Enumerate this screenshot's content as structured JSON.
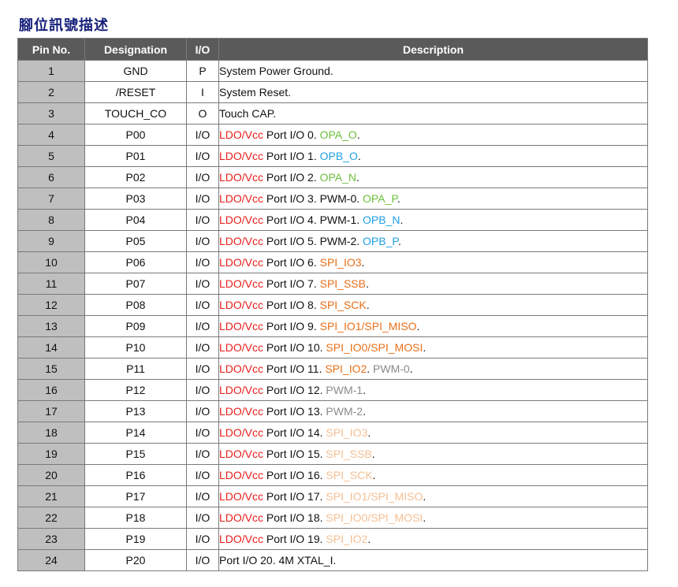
{
  "title": "腳位訊號描述",
  "colors": {
    "header_bg": "#5a5a5a",
    "pin_col_bg": "#bfbfbf",
    "title": "#16207a",
    "red": "#e8201c",
    "green": "#6cbf3a",
    "blue": "#1ea0e6",
    "orange": "#ea6f18",
    "gray": "#8a8a8a",
    "peach": "#f5bf93"
  },
  "headers": [
    "Pin No.",
    "Designation",
    "I/O",
    "Description"
  ],
  "rows": [
    {
      "pin": "1",
      "designation": "GND",
      "io": "P",
      "desc": [
        {
          "t": "System Power Ground.",
          "c": ""
        }
      ]
    },
    {
      "pin": "2",
      "designation": "/RESET",
      "io": "I",
      "desc": [
        {
          "t": "System Reset.",
          "c": ""
        }
      ]
    },
    {
      "pin": "3",
      "designation": "TOUCH_CO",
      "io": "O",
      "desc": [
        {
          "t": "Touch CAP.",
          "c": ""
        }
      ]
    },
    {
      "pin": "4",
      "designation": "P00",
      "io": "I/O",
      "desc": [
        {
          "t": "LDO/Vcc",
          "c": "red"
        },
        {
          "t": " Port I/O 0. ",
          "c": ""
        },
        {
          "t": "OPA_O",
          "c": "green"
        },
        {
          "t": ".",
          "c": ""
        }
      ]
    },
    {
      "pin": "5",
      "designation": "P01",
      "io": "I/O",
      "desc": [
        {
          "t": "LDO/Vcc",
          "c": "red"
        },
        {
          "t": " Port I/O 1. ",
          "c": ""
        },
        {
          "t": "OPB_O",
          "c": "blue"
        },
        {
          "t": ".",
          "c": ""
        }
      ]
    },
    {
      "pin": "6",
      "designation": "P02",
      "io": "I/O",
      "desc": [
        {
          "t": "LDO/Vcc",
          "c": "red"
        },
        {
          "t": " Port I/O 2. ",
          "c": ""
        },
        {
          "t": "OPA_N",
          "c": "green"
        },
        {
          "t": ".",
          "c": ""
        }
      ]
    },
    {
      "pin": "7",
      "designation": "P03",
      "io": "I/O",
      "desc": [
        {
          "t": "LDO/Vcc",
          "c": "red"
        },
        {
          "t": " Port I/O 3. PWM-0. ",
          "c": ""
        },
        {
          "t": "OPA_P",
          "c": "green"
        },
        {
          "t": ".",
          "c": ""
        }
      ]
    },
    {
      "pin": "8",
      "designation": "P04",
      "io": "I/O",
      "desc": [
        {
          "t": "LDO/Vcc",
          "c": "red"
        },
        {
          "t": " Port I/O 4. PWM-1. ",
          "c": ""
        },
        {
          "t": "OPB_N",
          "c": "blue"
        },
        {
          "t": ".",
          "c": ""
        }
      ]
    },
    {
      "pin": "9",
      "designation": "P05",
      "io": "I/O",
      "desc": [
        {
          "t": "LDO/Vcc",
          "c": "red"
        },
        {
          "t": " Port I/O 5. PWM-2. ",
          "c": ""
        },
        {
          "t": "OPB_P",
          "c": "blue"
        },
        {
          "t": ".",
          "c": ""
        }
      ]
    },
    {
      "pin": "10",
      "designation": "P06",
      "io": "I/O",
      "desc": [
        {
          "t": "LDO/Vcc",
          "c": "red"
        },
        {
          "t": " Port I/O 6. ",
          "c": ""
        },
        {
          "t": "SPI_IO3",
          "c": "orange"
        },
        {
          "t": ".",
          "c": ""
        }
      ]
    },
    {
      "pin": "11",
      "designation": "P07",
      "io": "I/O",
      "desc": [
        {
          "t": "LDO/Vcc",
          "c": "red"
        },
        {
          "t": " Port I/O 7. ",
          "c": ""
        },
        {
          "t": "SPI_SSB",
          "c": "orange"
        },
        {
          "t": ".",
          "c": ""
        }
      ]
    },
    {
      "pin": "12",
      "designation": "P08",
      "io": "I/O",
      "desc": [
        {
          "t": "LDO/Vcc",
          "c": "red"
        },
        {
          "t": " Port I/O 8. ",
          "c": ""
        },
        {
          "t": "SPI_SCK",
          "c": "orange"
        },
        {
          "t": ".",
          "c": ""
        }
      ]
    },
    {
      "pin": "13",
      "designation": "P09",
      "io": "I/O",
      "desc": [
        {
          "t": "LDO/Vcc",
          "c": "red"
        },
        {
          "t": " Port I/O 9. ",
          "c": ""
        },
        {
          "t": "SPI_IO1/SPI_MISO",
          "c": "orange"
        },
        {
          "t": ".",
          "c": ""
        }
      ]
    },
    {
      "pin": "14",
      "designation": "P10",
      "io": "I/O",
      "desc": [
        {
          "t": "LDO/Vcc",
          "c": "red"
        },
        {
          "t": " Port I/O 10. ",
          "c": ""
        },
        {
          "t": "SPI_IO0/SPI_MOSI",
          "c": "orange"
        },
        {
          "t": ".",
          "c": ""
        }
      ]
    },
    {
      "pin": "15",
      "designation": "P11",
      "io": "I/O",
      "desc": [
        {
          "t": "LDO/Vcc",
          "c": "red"
        },
        {
          "t": " Port I/O 11. ",
          "c": ""
        },
        {
          "t": "SPI_IO2",
          "c": "orange"
        },
        {
          "t": ". ",
          "c": ""
        },
        {
          "t": "PWM-0",
          "c": "gray"
        },
        {
          "t": ".",
          "c": ""
        }
      ]
    },
    {
      "pin": "16",
      "designation": "P12",
      "io": "I/O",
      "desc": [
        {
          "t": "LDO/Vcc",
          "c": "red"
        },
        {
          "t": " Port I/O 12. ",
          "c": ""
        },
        {
          "t": "PWM-1",
          "c": "gray"
        },
        {
          "t": ".",
          "c": ""
        }
      ]
    },
    {
      "pin": "17",
      "designation": "P13",
      "io": "I/O",
      "desc": [
        {
          "t": "LDO/Vcc",
          "c": "red"
        },
        {
          "t": " Port I/O 13. ",
          "c": ""
        },
        {
          "t": "PWM-2",
          "c": "gray"
        },
        {
          "t": ".",
          "c": ""
        }
      ]
    },
    {
      "pin": "18",
      "designation": "P14",
      "io": "I/O",
      "desc": [
        {
          "t": "LDO/Vcc",
          "c": "red"
        },
        {
          "t": " Port I/O 14. ",
          "c": ""
        },
        {
          "t": "SPI_IO3",
          "c": "peach"
        },
        {
          "t": ".",
          "c": ""
        }
      ]
    },
    {
      "pin": "19",
      "designation": "P15",
      "io": "I/O",
      "desc": [
        {
          "t": "LDO/Vcc",
          "c": "red"
        },
        {
          "t": " Port I/O 15. ",
          "c": ""
        },
        {
          "t": "SPI_SSB",
          "c": "peach"
        },
        {
          "t": ".",
          "c": ""
        }
      ]
    },
    {
      "pin": "20",
      "designation": "P16",
      "io": "I/O",
      "desc": [
        {
          "t": "LDO/Vcc",
          "c": "red"
        },
        {
          "t": " Port I/O 16. ",
          "c": ""
        },
        {
          "t": "SPI_SCK",
          "c": "peach"
        },
        {
          "t": ".",
          "c": ""
        }
      ]
    },
    {
      "pin": "21",
      "designation": "P17",
      "io": "I/O",
      "desc": [
        {
          "t": "LDO/Vcc",
          "c": "red"
        },
        {
          "t": " Port I/O 17. ",
          "c": ""
        },
        {
          "t": "SPI_IO1/SPI_MISO",
          "c": "peach"
        },
        {
          "t": ".",
          "c": ""
        }
      ]
    },
    {
      "pin": "22",
      "designation": "P18",
      "io": "I/O",
      "desc": [
        {
          "t": "LDO/Vcc",
          "c": "red"
        },
        {
          "t": " Port I/O 18. ",
          "c": ""
        },
        {
          "t": "SPI_IO0/SPI_MOSI",
          "c": "peach"
        },
        {
          "t": ".",
          "c": ""
        }
      ]
    },
    {
      "pin": "23",
      "designation": "P19",
      "io": "I/O",
      "desc": [
        {
          "t": "LDO/Vcc",
          "c": "red"
        },
        {
          "t": " Port I/O 19. ",
          "c": ""
        },
        {
          "t": "SPI_IO2",
          "c": "peach"
        },
        {
          "t": ".",
          "c": ""
        }
      ]
    },
    {
      "pin": "24",
      "designation": "P20",
      "io": "I/O",
      "desc": [
        {
          "t": "Port I/O 20. 4M XTAL_I.",
          "c": ""
        }
      ]
    }
  ]
}
